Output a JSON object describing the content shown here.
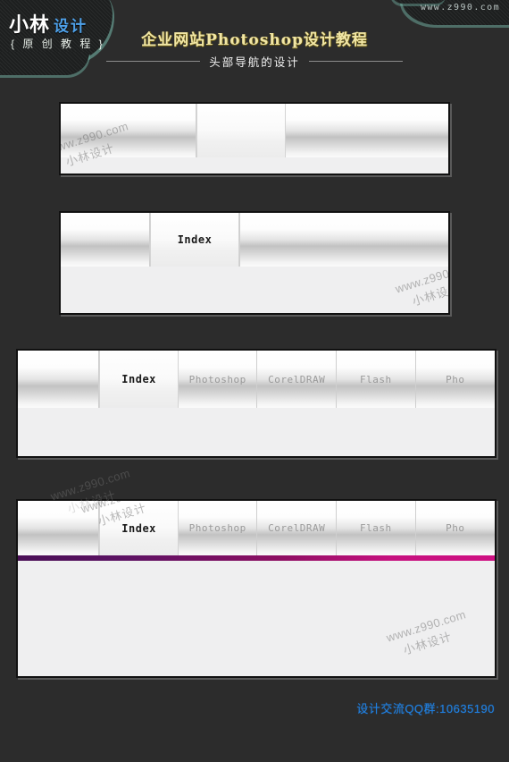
{
  "header": {
    "logo_line1_main": "小林",
    "logo_line1_sub": "设计",
    "logo_line2": "{ 原 创 教 程 }",
    "site_url": "www.z990.com",
    "title_main": "企业网站Photoshop设计教程",
    "title_sub": "头部导航的设计"
  },
  "watermark": {
    "line1": "www.z990.com",
    "line2": "小林设计"
  },
  "panels": [
    {
      "id": "panel-1",
      "step": 1,
      "cells": [
        "",
        "",
        ""
      ],
      "active_index": -1
    },
    {
      "id": "panel-2",
      "step": 2,
      "cells": [
        "",
        "Index",
        ""
      ],
      "active_index": 1
    },
    {
      "id": "panel-3",
      "step": 3,
      "cells": [
        "",
        "Index",
        "Photoshop",
        "CorelDRAW",
        "Flash",
        "Pho"
      ],
      "active_index": 1
    },
    {
      "id": "panel-4",
      "step": 4,
      "cells": [
        "",
        "Index",
        "Photoshop",
        "CorelDRAW",
        "Flash",
        "Pho"
      ],
      "active_index": 1,
      "accent_colors": [
        "#4a1056",
        "#8e0f63",
        "#cf1183"
      ]
    }
  ],
  "footer": {
    "qq_text": "设计交流QQ群:10635190"
  },
  "colors": {
    "background": "#2c2c2c",
    "title_gold": "#f1e6a5",
    "logo_blue": "#4ea0e8",
    "accent_purple": "#4a1056",
    "accent_magenta": "#cf1183",
    "footer_blue": "#1f7fe0"
  }
}
